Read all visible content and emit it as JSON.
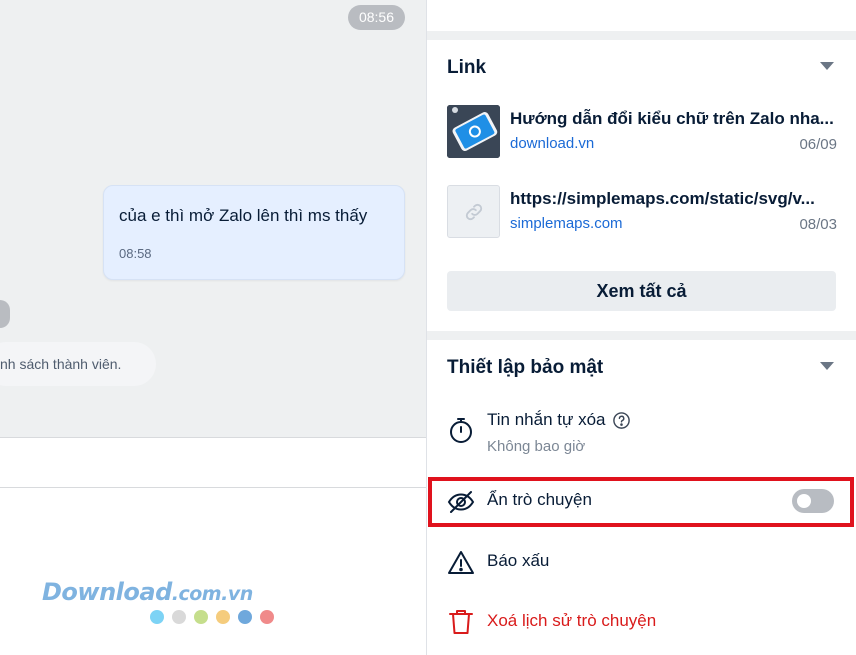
{
  "chat": {
    "top_time": "08:56",
    "message": {
      "text": "của e thì mở Zalo lên thì ms thấy",
      "time": "08:58"
    },
    "system_text": "nh sách thành viên."
  },
  "links": {
    "title": "Link",
    "items": [
      {
        "title": "Hướng dẫn đổi kiểu chữ trên Zalo nha...",
        "domain": "download.vn",
        "date": "06/09"
      },
      {
        "title": "https://simplemaps.com/static/svg/v...",
        "domain": "simplemaps.com",
        "date": "08/03"
      }
    ],
    "view_all": "Xem tất cả"
  },
  "security": {
    "title": "Thiết lập bảo mật",
    "auto_delete": {
      "label": "Tin nhắn tự xóa",
      "value": "Không bao giờ"
    },
    "hide_chat": {
      "label": "Ẩn trò chuyện",
      "enabled": false
    },
    "report": "Báo xấu",
    "delete_history": "Xoá lịch sử trò chuyện"
  },
  "watermark": {
    "brand": "Download",
    "suffix": ".com.vn"
  },
  "colors": {
    "accent_link": "#1b6ad6",
    "danger": "#e0121d",
    "delete_red": "#d91b1b",
    "watermark_dots": [
      "#7dd3f5",
      "#d9d9d9",
      "#c5de8c",
      "#f5cc7d",
      "#6fa8dc",
      "#f08a8a"
    ]
  },
  "icons": [
    "link-chain-icon",
    "timer-icon",
    "help-circle-icon",
    "eye-off-icon",
    "warning-icon",
    "trash-icon",
    "caret-down-icon"
  ]
}
